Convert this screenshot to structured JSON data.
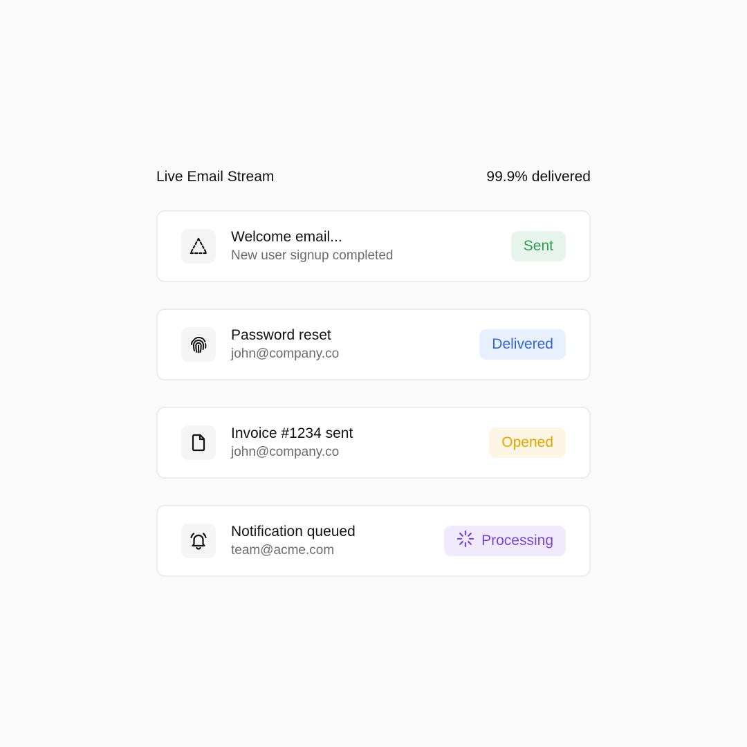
{
  "header": {
    "title": "Live Email Stream",
    "delivery_rate": "99.9% delivered"
  },
  "emails": [
    {
      "title": "Welcome email...",
      "subtitle": "New user signup completed",
      "icon": "dashed-triangle-icon",
      "status": "Sent",
      "status_color": "#2f9a55",
      "status_bg": "#e8f5ec"
    },
    {
      "title": "Password reset",
      "subtitle": "john@company.co",
      "icon": "fingerprint-icon",
      "status": "Delivered",
      "status_color": "#3366d6",
      "status_bg": "#e8effd"
    },
    {
      "title": "Invoice #1234 sent",
      "subtitle": "john@company.co",
      "icon": "document-icon",
      "status": "Opened",
      "status_color": "#e0a800",
      "status_bg": "#fdf5e3"
    },
    {
      "title": "Notification queued",
      "subtitle": "team@acme.com",
      "icon": "bell-icon",
      "status": "Processing",
      "status_icon": "spinner-icon",
      "status_color": "#7b45d8",
      "status_bg": "#f1eafc"
    }
  ]
}
